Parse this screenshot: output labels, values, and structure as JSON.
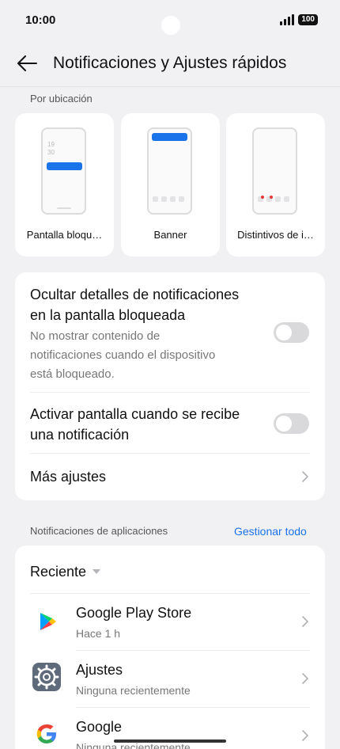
{
  "status": {
    "time": "10:00",
    "battery": "100"
  },
  "header": {
    "title": "Notificaciones y Ajustes rápidos"
  },
  "location_section": {
    "label": "Por ubicación",
    "styles": [
      {
        "label": "Pantalla bloqu…",
        "clock_top": "19",
        "clock_bottom": "30"
      },
      {
        "label": "Banner"
      },
      {
        "label": "Distintivos de i…"
      }
    ]
  },
  "settings": {
    "hide_details": {
      "title_line1": "Ocultar detalles de notificaciones",
      "title_line2": "en la pantalla bloqueada",
      "sub_line1": "No mostrar contenido de",
      "sub_line2": "notificaciones cuando el dispositivo",
      "sub_line3": "está bloqueado.",
      "on": false
    },
    "wake_screen": {
      "title_line1": "Activar pantalla cuando se recibe",
      "title_line2": "una notificación",
      "on": false
    },
    "more": {
      "title": "Más ajustes"
    }
  },
  "apps_section": {
    "label": "Notificaciones de aplicaciones",
    "manage_all": "Gestionar todo",
    "sort_label": "Reciente",
    "apps": [
      {
        "name": "Google Play Store",
        "sub": "Hace 1 h",
        "icon": "play-store-icon"
      },
      {
        "name": "Ajustes",
        "sub": "Ninguna recientemente",
        "icon": "settings-gear-icon"
      },
      {
        "name": "Google",
        "sub": "Ninguna recientemente",
        "icon": "google-g-icon"
      }
    ]
  },
  "colors": {
    "accent": "#1a73e8",
    "background": "#f1f1f3",
    "toggle_off": "#d9d9dc"
  }
}
